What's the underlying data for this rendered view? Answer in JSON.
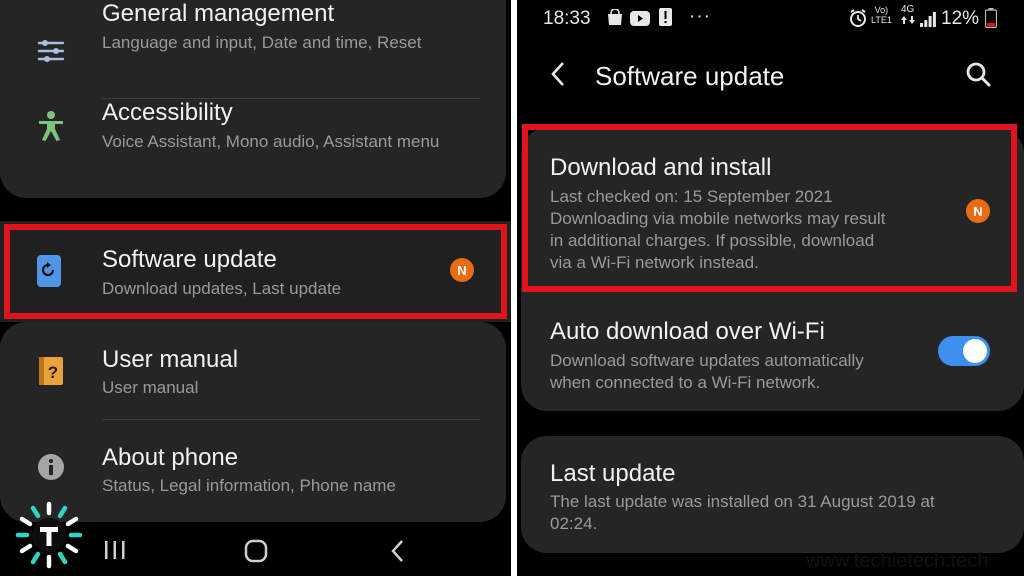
{
  "left_phone": {
    "settings_items": [
      {
        "title": "General management",
        "subtitle": "Language and input, Date and time, Reset",
        "icon": "sliders-icon"
      },
      {
        "title": "Accessibility",
        "subtitle": "Voice Assistant, Mono audio, Assistant menu",
        "icon": "accessibility-icon"
      },
      {
        "title": "Software update",
        "subtitle": "Download updates, Last update",
        "icon": "software-update-icon",
        "badge": "N"
      },
      {
        "title": "User manual",
        "subtitle": "User manual",
        "icon": "user-manual-icon"
      },
      {
        "title": "About phone",
        "subtitle": "Status, Legal information, Phone name",
        "icon": "info-icon"
      }
    ],
    "nav_bar": [
      "recents-icon",
      "home-icon",
      "back-icon"
    ]
  },
  "right_phone": {
    "status_bar": {
      "time": "18:33",
      "dots": "···",
      "battery_percent": "12%",
      "network_top": "Vo)",
      "network_bottom": "LTE1",
      "data_type": "4G"
    },
    "app_bar": {
      "title": "Software update"
    },
    "download_install": {
      "title": "Download and install",
      "lines": [
        "Last checked on: 15 September 2021",
        "Downloading via mobile networks may result",
        "in additional charges. If possible, download",
        "via a Wi-Fi network instead."
      ],
      "badge": "N"
    },
    "auto_download": {
      "title": "Auto download over Wi-Fi",
      "lines": [
        "Download software updates automatically",
        "when connected to a Wi-Fi network."
      ],
      "toggle_on": true
    },
    "last_update": {
      "title": "Last update",
      "lines": [
        "The last update was installed on 31 August 2019 at",
        "02:24."
      ]
    }
  },
  "watermark": "www.techietech.tech",
  "colors": {
    "highlight_red": "#e0141c",
    "badge_orange": "#e96c15",
    "toggle_blue": "#3e8ff0",
    "card_bg": "#252525"
  }
}
